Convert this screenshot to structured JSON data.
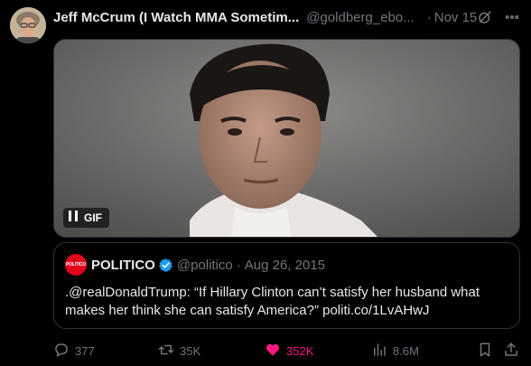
{
  "post": {
    "author_name": "Jeff McCrum (I Watch MMA Sometim...",
    "author_handle": "@goldberg_ebo...",
    "separator": "·",
    "date": "Nov 15"
  },
  "media": {
    "badge_label": "GIF"
  },
  "quoted_post": {
    "avatar_text": "POLITICO",
    "author_name": "POLITICO",
    "author_handle": "@politico",
    "separator": "·",
    "date": "Aug 26, 2015",
    "text": ".@realDonaldTrump: “If Hillary Clinton can’t satisfy her husband what makes her think she can satisfy America?” politi.co/1LvAHwJ"
  },
  "actions": {
    "replies": "377",
    "reposts": "35K",
    "likes": "352K",
    "views": "8.6M"
  },
  "colors": {
    "background": "#000000",
    "text_primary": "#e7e9ea",
    "text_secondary": "#71767b",
    "like_active": "#f91880",
    "verified": "#1d9bf0",
    "politico_red": "#e0001b",
    "border": "#2f3336"
  },
  "icons": {
    "header": [
      "grok-icon",
      "more-icon"
    ],
    "actions": [
      "reply-icon",
      "repost-icon",
      "heart-filled-icon",
      "views-icon",
      "bookmark-icon",
      "share-icon"
    ],
    "media": [
      "pause-icon"
    ],
    "quoted": [
      "verified-badge-icon"
    ]
  }
}
